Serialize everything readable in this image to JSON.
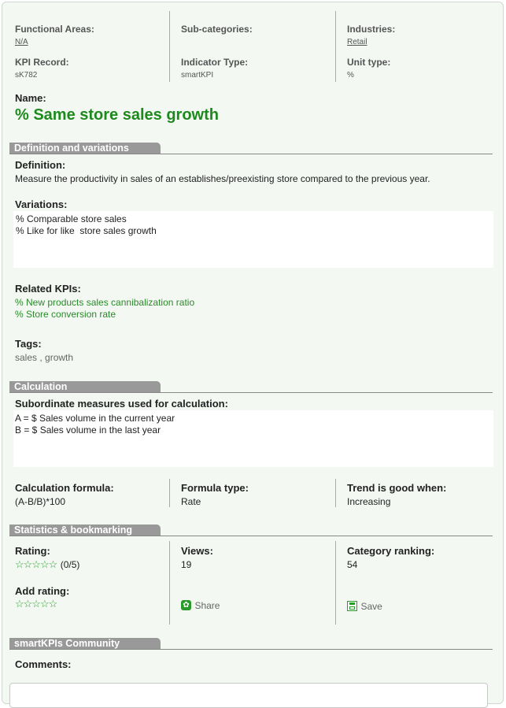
{
  "meta": {
    "functional_areas_label": "Functional Areas:",
    "functional_areas_value": "N/A",
    "subcategories_label": "Sub-categories:",
    "industries_label": "Industries:",
    "industries_value": "Retail",
    "kpi_record_label": "KPI Record:",
    "kpi_record_value": "sK782",
    "indicator_type_label": "Indicator Type:",
    "indicator_type_value": "smartKPI",
    "unit_type_label": "Unit type:",
    "unit_type_value": "%"
  },
  "name": {
    "label": "Name:",
    "value": "% Same store sales growth"
  },
  "definition_section": {
    "title": "Definition and variations",
    "definition_label": "Definition:",
    "definition_text": "Measure the productivity in sales of an establishes/preexisting store compared to the previous year.",
    "variations_label": "Variations:",
    "variations": [
      "% Comparable store sales",
      "% Like for like  store sales growth"
    ],
    "related_label": "Related KPIs:",
    "related": [
      "% New products sales cannibalization ratio",
      "% Store conversion rate"
    ],
    "tags_label": "Tags:",
    "tags": [
      "sales",
      "growth"
    ],
    "tag_separator": " , "
  },
  "calculation_section": {
    "title": "Calculation",
    "subordinate_label": "Subordinate measures used for calculation:",
    "measures": [
      "A = $ Sales volume in the current year",
      "B = $ Sales volume in the last year"
    ],
    "formula_label": "Calculation formula:",
    "formula_value": "(A-B/B)*100",
    "formula_type_label": "Formula type:",
    "formula_type_value": "Rate",
    "trend_label": "Trend is good when:",
    "trend_value": "Increasing"
  },
  "statistics_section": {
    "title": "Statistics & bookmarking",
    "rating_label": "Rating:",
    "rating_value": "(0/5)",
    "rating_stars": 0,
    "add_rating_label": "Add rating:",
    "views_label": "Views:",
    "views_value": "19",
    "share_label": "Share",
    "ranking_label": "Category ranking:",
    "ranking_value": "54",
    "save_label": "Save"
  },
  "community_section": {
    "title": "smartKPIs Community",
    "comments_label": "Comments:"
  },
  "colors": {
    "accent_green": "#1e8a1e",
    "section_tab": "#999999",
    "panel_bg": "#f3f8f3"
  },
  "icons": {
    "star": "star-outline-icon",
    "share": "share-icon",
    "save": "save-icon"
  }
}
